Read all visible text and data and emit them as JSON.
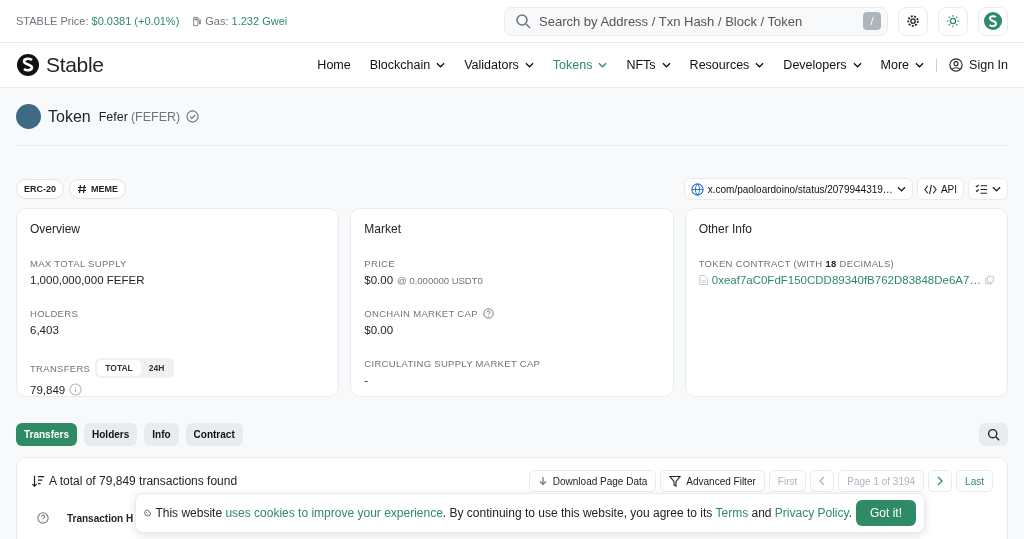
{
  "topbar": {
    "price_label": "STABLE Price:",
    "price_value": "$0.0381 (+0.01%)",
    "gas_label": "Gas:",
    "gas_value": "1.232 Gwei",
    "search_placeholder": "Search by Address / Txn Hash / Block / Token",
    "shortcut": "/"
  },
  "nav": {
    "brand": "Stable",
    "items": [
      {
        "label": "Home",
        "dropdown": false,
        "selected": false
      },
      {
        "label": "Blockchain",
        "dropdown": true,
        "selected": false
      },
      {
        "label": "Validators",
        "dropdown": true,
        "selected": false
      },
      {
        "label": "Tokens",
        "dropdown": true,
        "selected": true
      },
      {
        "label": "NFTs",
        "dropdown": true,
        "selected": false
      },
      {
        "label": "Resources",
        "dropdown": true,
        "selected": false
      },
      {
        "label": "Developers",
        "dropdown": true,
        "selected": false
      },
      {
        "label": "More",
        "dropdown": true,
        "selected": false
      }
    ],
    "sign_in": "Sign In"
  },
  "token": {
    "title": "Token",
    "name": "Fefer",
    "symbol": "(FEFER)",
    "verified": true
  },
  "badges": [
    {
      "label": "ERC-20",
      "kind": "plain"
    },
    {
      "label": "MEME",
      "kind": "hashtag"
    }
  ],
  "links": {
    "social": "x.com/paoloardoino/status/2079944319…",
    "api": "API"
  },
  "overview": {
    "title": "Overview",
    "items": [
      {
        "label": "MAX TOTAL SUPPLY",
        "value": "1,000,000,000 FEFER"
      },
      {
        "label": "HOLDERS",
        "value": "6,403"
      }
    ],
    "transfers_label": "TRANSFERS",
    "transfers_toggle": [
      {
        "label": "TOTAL",
        "selected": true
      },
      {
        "label": "24H",
        "selected": false
      }
    ],
    "transfers_value": "79,849"
  },
  "market": {
    "title": "Market",
    "price_label": "PRICE",
    "price": "$0.00",
    "price_sub": "@ 0.000000 USDT0",
    "cap_label": "ONCHAIN MARKET CAP",
    "cap": "$0.00",
    "circ_label": "CIRCULATING SUPPLY MARKET CAP",
    "circ": "-"
  },
  "other_info": {
    "title": "Other Info",
    "contract_label": "TOKEN CONTRACT (WITH **18** DECIMALS)",
    "contract": "0xeaf7aC0FdF150CDD89340fB762D83848De6A7…"
  },
  "tabs": [
    {
      "label": "Transfers",
      "selected": true
    },
    {
      "label": "Holders",
      "selected": false
    },
    {
      "label": "Info",
      "selected": false
    },
    {
      "label": "Contract",
      "selected": false
    }
  ],
  "table": {
    "summary": "A total of 79,849 transactions found",
    "download": "Download Page Data",
    "filter": "Advanced Filter",
    "first": "First",
    "page": "Page 1 of 3194",
    "last": "Last",
    "column_1": "Transaction H"
  },
  "cookie": {
    "parts": [
      {
        "text": "This website ",
        "link": false
      },
      {
        "text": "uses cookies to improve your experience",
        "link": true
      },
      {
        "text": ". By continuing to use this website, you agree to its ",
        "link": false
      },
      {
        "text": "Terms",
        "link": true
      },
      {
        "text": " and ",
        "link": false
      },
      {
        "text": "Privacy Policy",
        "link": true
      },
      {
        "text": ".",
        "link": false
      }
    ],
    "button": "Got it!"
  }
}
